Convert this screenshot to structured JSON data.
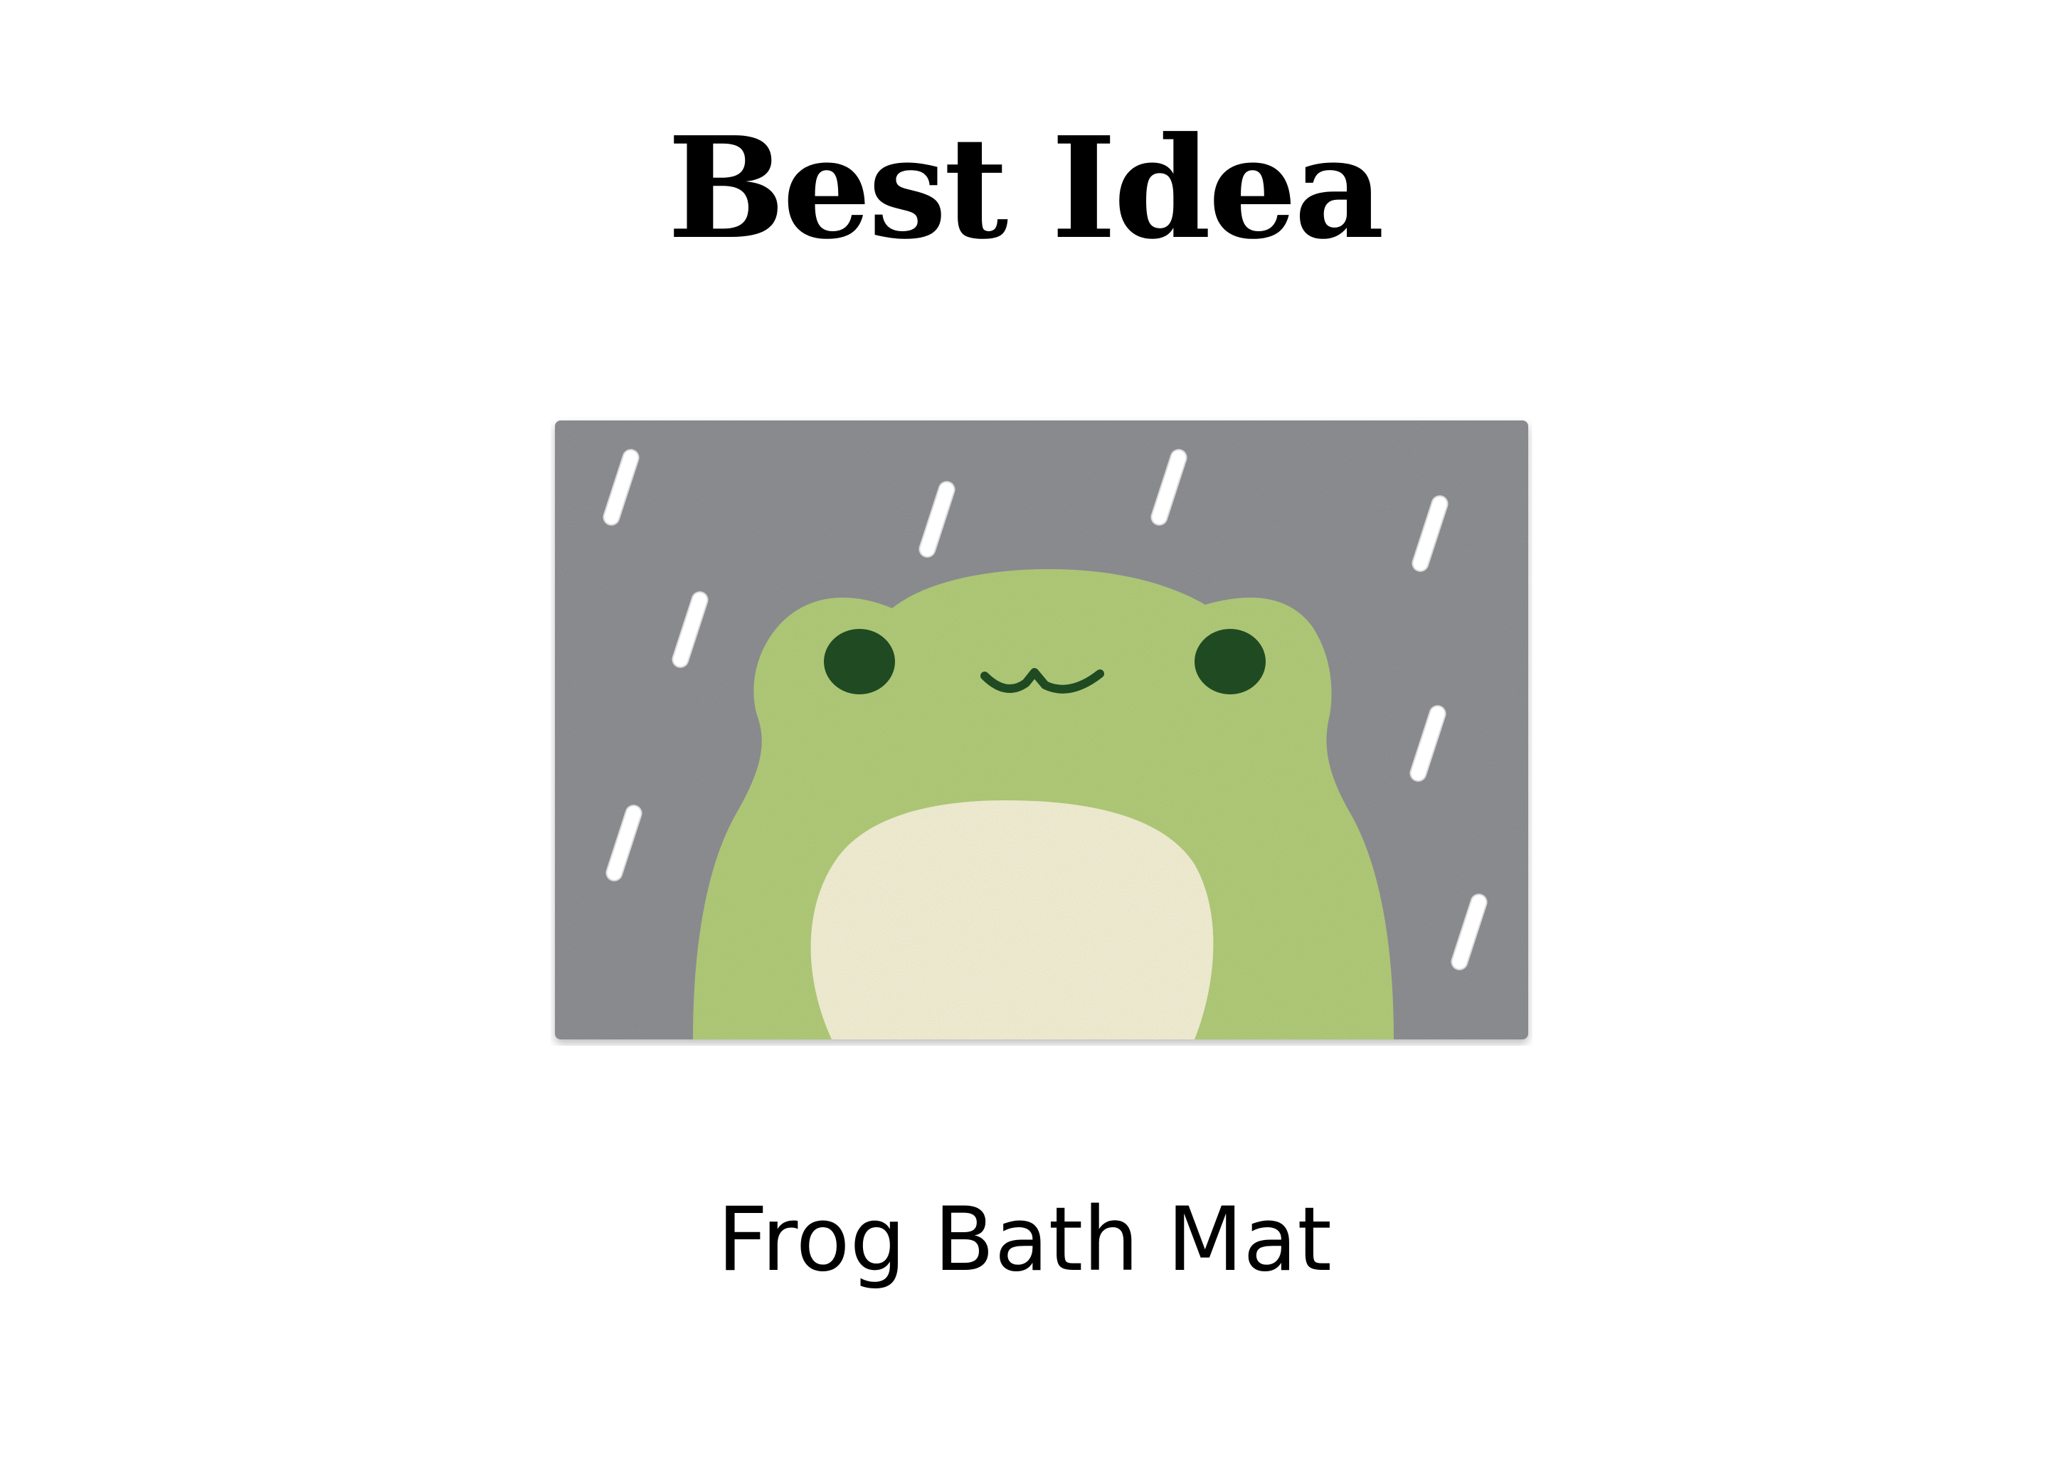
{
  "heading": {
    "title": "Best Idea"
  },
  "product": {
    "image_subject": "frog-bath-mat-image",
    "caption": "Frog Bath Mat"
  },
  "colors": {
    "background": "#ffffff",
    "text": "#000000",
    "mat_gray": "#8f9094",
    "frog_green": "#b3cd7a",
    "belly_cream": "#f4f1d6",
    "eye_green": "#1f4a22",
    "raindrop_white": "#ffffff"
  }
}
